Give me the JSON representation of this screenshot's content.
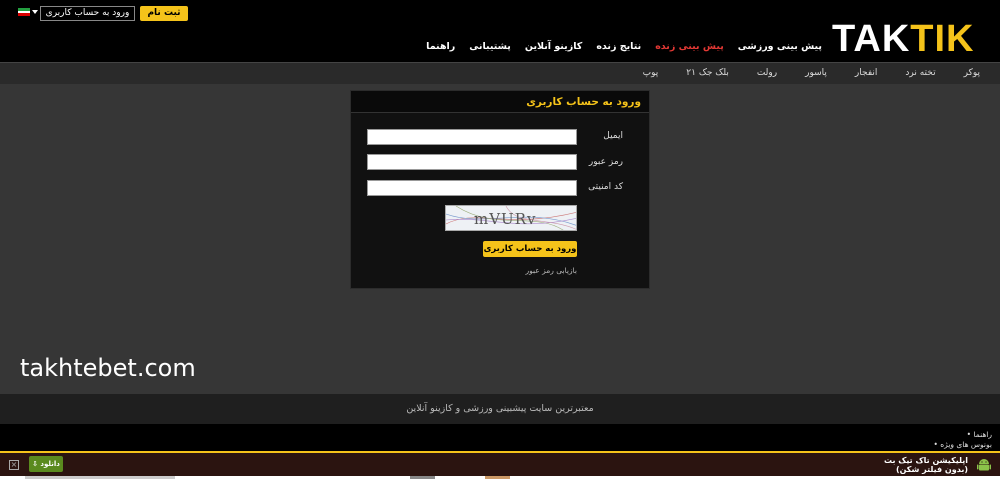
{
  "header": {
    "logo_light": "TAK",
    "logo_yellow": "TIK",
    "register_label": "ثبت نام",
    "login_label": "ورود به حساب کاربری"
  },
  "mainnav": [
    "پیش بینی ورزشی",
    "پیش بینی زنده",
    "نتایج زنده",
    "کازینو آنلاین",
    "پشتیبانی",
    "راهنما"
  ],
  "subnav": [
    "پوکر",
    "تخته نرد",
    "انفجار",
    "پاسور",
    "رولت",
    "بلک جک ۲۱",
    "پوپ"
  ],
  "login_box": {
    "title": "ورود به حساب کاربری",
    "email_label": "ایمیل",
    "password_label": "رمز عبور",
    "security_label": "کد امنیتی",
    "captcha_text": "mVURv",
    "submit_label": "ورود به حساب کاربری",
    "forgot_label": "بازیابی رمز عبور"
  },
  "watermark": "takhtebet.com",
  "footer": {
    "tagline": "معتبرترین سایت پیشبینی ورزشی و کازینو آنلاین",
    "link1": "• راهنما",
    "link2": "• بونوس های ویژه"
  },
  "appbar": {
    "download_label": "دانلود",
    "title_line1": "اپلیکیشن تاک تیک بت",
    "title_line2": "(بدون فیلتر شکن)",
    "close_symbol": "×"
  },
  "colors": {
    "accent": "#f5c31a",
    "active_nav": "#e53935",
    "download": "#5a8a1e"
  }
}
